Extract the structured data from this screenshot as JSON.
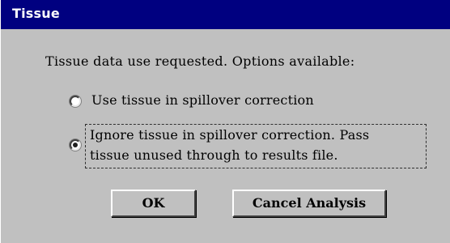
{
  "window": {
    "title": "Tissue"
  },
  "prompt": "Tissue data use requested.  Options available:",
  "options": [
    {
      "line1": "Use tissue in spillover correction",
      "line2": "",
      "selected": false
    },
    {
      "line1": "Ignore tissue in spillover correction.  Pass",
      "line2": "tissue unused through to results file.",
      "selected": true
    }
  ],
  "buttons": {
    "ok": "OK",
    "cancel": "Cancel Analysis"
  },
  "colors": {
    "titlebar": "#000080",
    "face": "#c0c0c0"
  }
}
